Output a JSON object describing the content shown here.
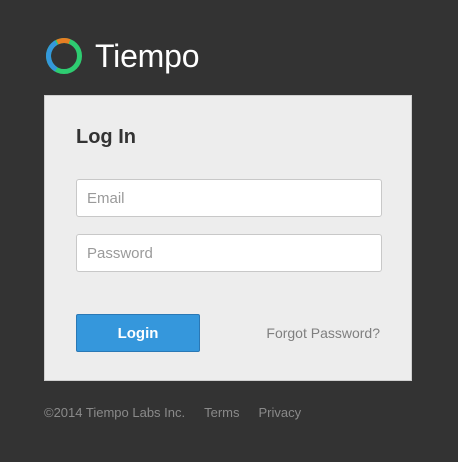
{
  "brand": {
    "name": "Tiempo",
    "logo_icon": "tiempo-ring-logo",
    "logo_colors": [
      "#2ecc71",
      "#3498db",
      "#e67e22"
    ]
  },
  "login": {
    "title": "Log In",
    "email_placeholder": "Email",
    "email_value": "",
    "password_placeholder": "Password",
    "password_value": "",
    "submit_label": "Login",
    "forgot_label": "Forgot Password?"
  },
  "footer": {
    "copyright": "©2014 Tiempo Labs Inc.",
    "links": [
      "Terms",
      "Privacy"
    ]
  },
  "colors": {
    "background": "#333333",
    "card": "#ededed",
    "primary_button": "#3597dc"
  }
}
